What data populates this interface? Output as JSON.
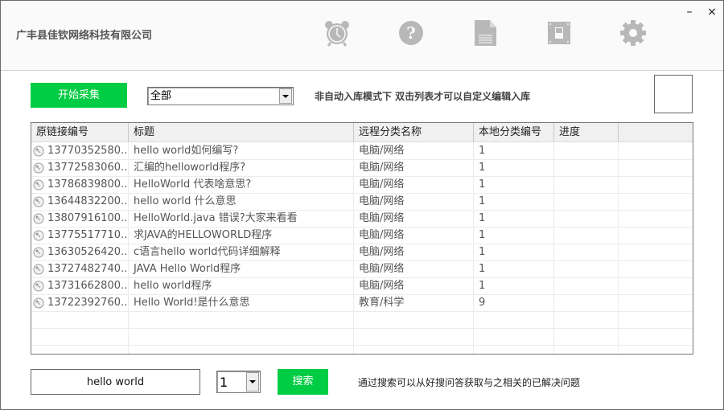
{
  "header": {
    "company_name": "广丰县佳钦网络科技有限公司",
    "toolbar_icons": [
      "alarm-clock-icon",
      "help-icon",
      "document-icon",
      "switch-icon",
      "gear-icon"
    ],
    "minimize_label": "–",
    "close_label": "×"
  },
  "controls": {
    "start_button": "开始采集",
    "category_select": {
      "selected": "全部"
    },
    "mode_hint": "非自动入库模式下  双击列表才可以自定义编辑入库"
  },
  "table": {
    "columns": [
      "原链接编号",
      "标题",
      "远程分类名称",
      "本地分类编号",
      "进度",
      ""
    ],
    "rows": [
      {
        "id": "13770352580...",
        "title": "hello world如何编写?",
        "remote_category": "电脑/网络",
        "local_id": "1",
        "progress": ""
      },
      {
        "id": "13772583060...",
        "title": "汇编的helloworld程序?",
        "remote_category": "电脑/网络",
        "local_id": "1",
        "progress": ""
      },
      {
        "id": "13786839800...",
        "title": "HelloWorld 代表啥意思?",
        "remote_category": "电脑/网络",
        "local_id": "1",
        "progress": ""
      },
      {
        "id": "13644832200...",
        "title": "hello world 什么意思",
        "remote_category": "电脑/网络",
        "local_id": "1",
        "progress": ""
      },
      {
        "id": "13807916100...",
        "title": "HelloWorld.java 错误?大家来看看",
        "remote_category": "电脑/网络",
        "local_id": "1",
        "progress": ""
      },
      {
        "id": "13775517710...",
        "title": "求JAVA的HELLOWORLD程序",
        "remote_category": "电脑/网络",
        "local_id": "1",
        "progress": ""
      },
      {
        "id": "13630526420...",
        "title": "c语言hello world代码详细解释",
        "remote_category": "电脑/网络",
        "local_id": "1",
        "progress": ""
      },
      {
        "id": "13727482740...",
        "title": "JAVA Hello World程序",
        "remote_category": "电脑/网络",
        "local_id": "1",
        "progress": ""
      },
      {
        "id": "13731662800...",
        "title": "hello world程序",
        "remote_category": "电脑/网络",
        "local_id": "1",
        "progress": ""
      },
      {
        "id": "13722392760...",
        "title": "Hello World!是什么意思",
        "remote_category": "教育/科学",
        "local_id": "9",
        "progress": ""
      }
    ]
  },
  "search": {
    "query": "hello world",
    "page_select": {
      "selected": "1"
    },
    "button": "搜索",
    "hint": "通过搜索可以从好搜问答获取与之相关的已解决问题"
  },
  "colors": {
    "accent_green": "#00cc44",
    "icon_gray": "#b8b8b8"
  }
}
